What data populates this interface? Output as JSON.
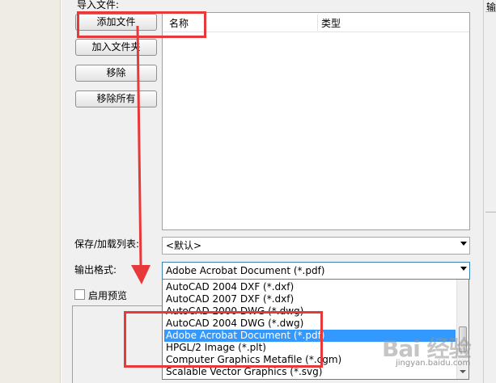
{
  "dialog": {
    "group_label": "导入文件:",
    "right_label": "输"
  },
  "buttons": {
    "add_file": "添加文件",
    "add_folder": "加入文件夹",
    "remove": "移除",
    "remove_all": "移除所有"
  },
  "file_list": {
    "columns": [
      "名称",
      "类型"
    ]
  },
  "save_load": {
    "label": "保存/加载列表:",
    "value": "<默认>"
  },
  "output_format": {
    "label": "输出格式:",
    "value": "Adobe Acrobat Document (*.pdf)",
    "options": [
      "AutoCAD 2004 DXF (*.dxf)",
      "AutoCAD 2007 DXF (*.dxf)",
      "AutoCAD 2000 DWG (*.dwg)",
      "AutoCAD 2004 DWG (*.dwg)",
      "Adobe Acrobat Document (*.pdf)",
      "HPGL/2 Image (*.plt)",
      "Computer Graphics Metafile (*.cgm)",
      "Scalable Vector Graphics (*.svg)"
    ],
    "selected_index": 4
  },
  "preview": {
    "label": "启用预览",
    "checked": false
  },
  "watermark": {
    "text": "Bai 经验",
    "sub": "jingyan.baidu.com"
  },
  "colors": {
    "annotation_red": "#e8393a",
    "selection_blue": "#3399ff"
  }
}
